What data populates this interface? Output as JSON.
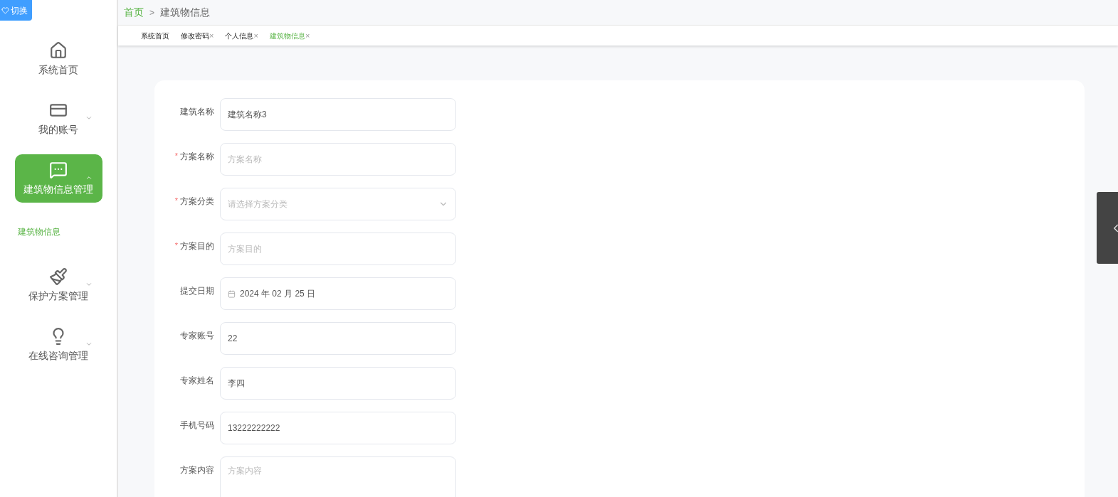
{
  "switch_button": {
    "label": "切换"
  },
  "sidebar": {
    "items": [
      {
        "label": "系统首页",
        "selected": false
      },
      {
        "label": "我的账号",
        "selected": false,
        "expanded": false
      },
      {
        "label": "建筑物信息管理",
        "selected": true,
        "expanded": true,
        "children": [
          {
            "label": "建筑物信息",
            "selected": true
          }
        ]
      },
      {
        "label": "保护方案管理",
        "selected": false,
        "expanded": false
      },
      {
        "label": "在线咨询管理",
        "selected": false,
        "expanded": false
      }
    ]
  },
  "breadcrumb": [
    {
      "label": "首页",
      "link": true
    },
    {
      "label": "建筑物信息",
      "link": false
    }
  ],
  "breadcrumb_separator": ">",
  "tabs": [
    {
      "label": "系统首页",
      "selected": false
    },
    {
      "label": "修改密码",
      "selected": false,
      "close": "×"
    },
    {
      "label": "个人信息",
      "selected": false,
      "close": "×"
    },
    {
      "label": "建筑物信息",
      "selected": true,
      "close": "×"
    }
  ],
  "form": {
    "fields": [
      {
        "kind": "text",
        "label": "建筑名称",
        "value": "建筑名称3"
      },
      {
        "kind": "text",
        "label": "方案名称",
        "required_mark": "*",
        "placeholder": "方案名称"
      },
      {
        "kind": "select",
        "label": "方案分类",
        "required_mark": "*",
        "placeholder": "请选择方案分类"
      },
      {
        "kind": "text",
        "label": "方案目的",
        "required_mark": "*",
        "placeholder": "方案目的"
      },
      {
        "kind": "date",
        "label": "提交日期",
        "value": "2024 年 02 月 25 日"
      },
      {
        "kind": "text",
        "label": "专家账号",
        "value": "22"
      },
      {
        "kind": "text",
        "label": "专家姓名",
        "value": "李四"
      },
      {
        "kind": "text",
        "label": "手机号码",
        "value": "13222222222"
      },
      {
        "kind": "textarea",
        "label": "方案内容",
        "placeholder": "方案内容"
      }
    ]
  }
}
